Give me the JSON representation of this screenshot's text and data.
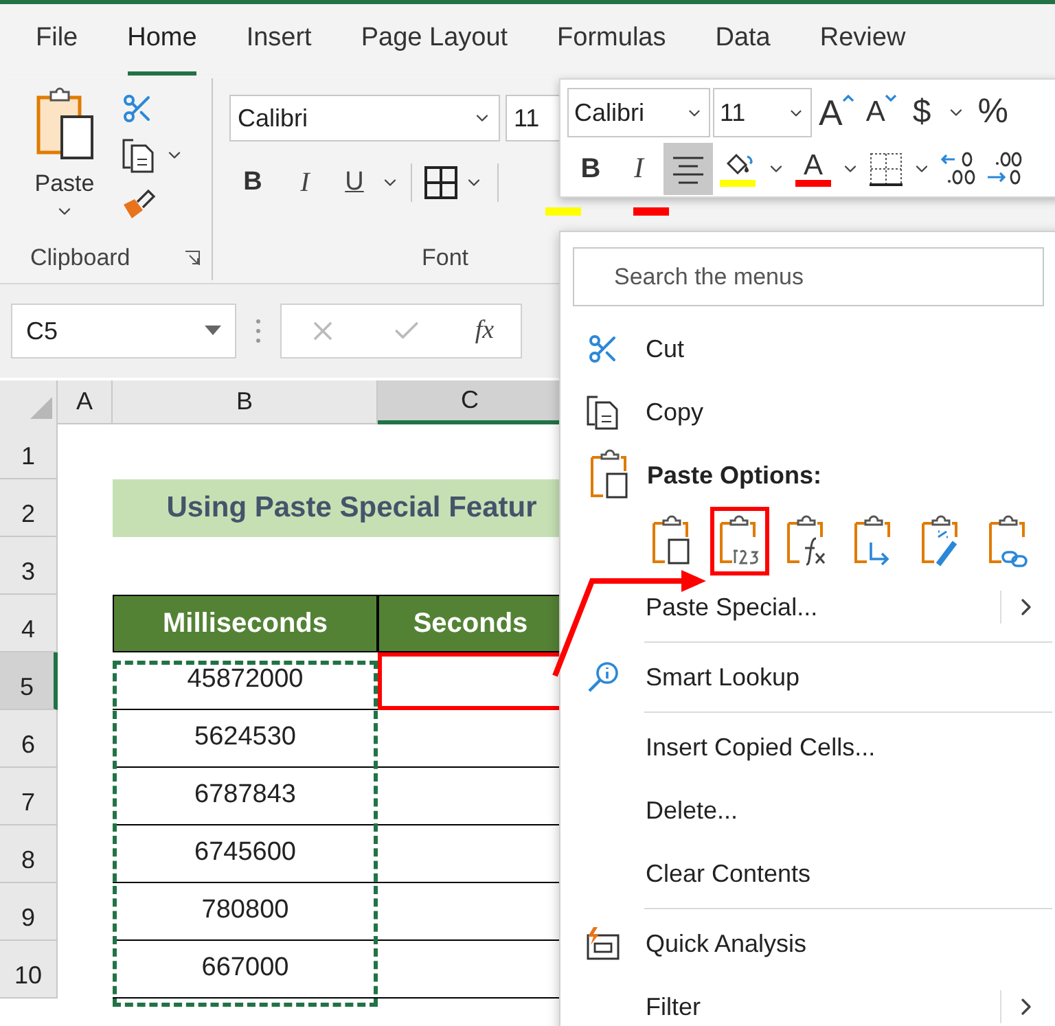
{
  "ribbon_tabs": [
    {
      "label": "File",
      "selected": false
    },
    {
      "label": "Home",
      "selected": true
    },
    {
      "label": "Insert",
      "selected": false
    },
    {
      "label": "Page Layout",
      "selected": false
    },
    {
      "label": "Formulas",
      "selected": false
    },
    {
      "label": "Data",
      "selected": false
    },
    {
      "label": "Review",
      "selected": false
    }
  ],
  "clipboard_group": {
    "paste_label": "Paste",
    "label": "Clipboard"
  },
  "font_group": {
    "font": "Calibri",
    "size": "11",
    "bold": "B",
    "italic": "I",
    "underline": "U",
    "label": "Font"
  },
  "formula_bar": {
    "name_box": "C5",
    "fx": "fx"
  },
  "sheet": {
    "columns": [
      {
        "label": "A",
        "selected": false
      },
      {
        "label": "B",
        "selected": false
      },
      {
        "label": "C",
        "selected": true
      }
    ],
    "rows": [
      {
        "number": "1",
        "kind": "blank",
        "selected": false
      },
      {
        "number": "2",
        "kind": "title",
        "selected": false,
        "cells": [
          "Using Paste Special Featur"
        ]
      },
      {
        "number": "3",
        "kind": "blank",
        "selected": false
      },
      {
        "number": "4",
        "kind": "header",
        "selected": false,
        "cells": [
          "Milliseconds",
          "Seconds"
        ]
      },
      {
        "number": "5",
        "kind": "data",
        "selected": true,
        "target": true,
        "cells": [
          "45872000"
        ]
      },
      {
        "number": "6",
        "kind": "data",
        "selected": false,
        "target": false,
        "cells": [
          "5624530"
        ]
      },
      {
        "number": "7",
        "kind": "data",
        "selected": false,
        "target": false,
        "cells": [
          "6787843"
        ]
      },
      {
        "number": "8",
        "kind": "data",
        "selected": false,
        "target": false,
        "cells": [
          "6745600"
        ]
      },
      {
        "number": "9",
        "kind": "data",
        "selected": false,
        "target": false,
        "cells": [
          "780800"
        ]
      },
      {
        "number": "10",
        "kind": "data",
        "selected": false,
        "target": false,
        "cells": [
          "667000"
        ]
      }
    ]
  },
  "mini_toolbar": {
    "font": "Calibri",
    "size": "11",
    "row1": [
      {
        "kind": "grow",
        "label": "A"
      },
      {
        "kind": "shrink",
        "label": "A"
      },
      {
        "kind": "currency",
        "label": "$"
      },
      {
        "kind": "caret"
      },
      {
        "kind": "percent",
        "label": "%"
      }
    ],
    "row2": [
      {
        "kind": "bold",
        "label": "B",
        "selected": false
      },
      {
        "kind": "italic",
        "label": "I",
        "selected": false
      },
      {
        "kind": "center",
        "selected": true
      },
      {
        "kind": "fill",
        "selected": false
      },
      {
        "kind": "caret",
        "selected": false
      },
      {
        "kind": "fontcolor",
        "label": "A",
        "selected": false
      },
      {
        "kind": "caret",
        "selected": false
      },
      {
        "kind": "borders",
        "selected": false
      },
      {
        "kind": "caret",
        "selected": false
      },
      {
        "kind": "decdec",
        "selected": false
      },
      {
        "kind": "incdec",
        "selected": false
      }
    ]
  },
  "context_menu": {
    "search_placeholder": "Search the menus",
    "items": [
      {
        "kind": "item",
        "label": "Cut",
        "submenu": false
      },
      {
        "kind": "item",
        "label": "Copy",
        "submenu": false
      },
      {
        "kind": "header",
        "label": "Paste Options:"
      },
      {
        "kind": "paste_options",
        "options": [
          {
            "highlighted": false
          },
          {
            "highlighted": true
          },
          {
            "highlighted": false
          },
          {
            "highlighted": false
          },
          {
            "highlighted": false
          },
          {
            "highlighted": false
          }
        ]
      },
      {
        "kind": "item",
        "label": "Paste Special...",
        "submenu": true
      },
      {
        "kind": "separator"
      },
      {
        "kind": "item",
        "label": "Smart Lookup",
        "submenu": false
      },
      {
        "kind": "separator"
      },
      {
        "kind": "item",
        "label": "Insert Copied Cells...",
        "submenu": false
      },
      {
        "kind": "item",
        "label": "Delete...",
        "submenu": false
      },
      {
        "kind": "item",
        "label": "Clear Contents",
        "submenu": false
      },
      {
        "kind": "separator"
      },
      {
        "kind": "item",
        "label": "Quick Analysis",
        "submenu": false
      },
      {
        "kind": "item",
        "label": "Filter",
        "submenu": true
      }
    ]
  }
}
